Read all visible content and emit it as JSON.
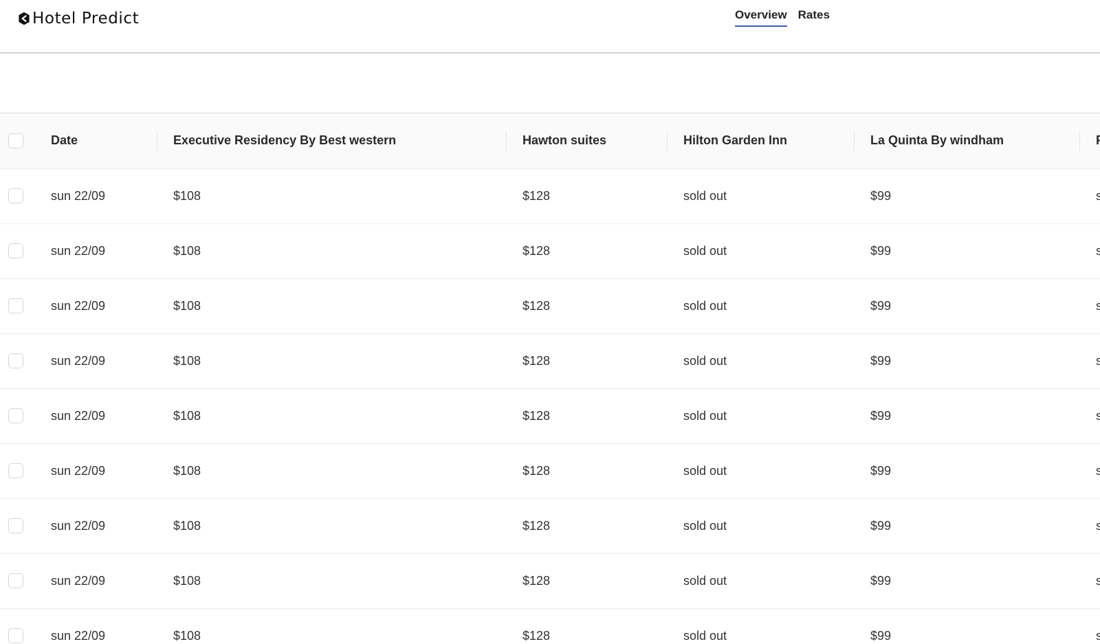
{
  "app": {
    "brand": "Hotel Predict",
    "nav": [
      {
        "label": "Overview",
        "active": true
      },
      {
        "label": "Rates",
        "active": false
      }
    ],
    "accent_color": "#3b5bdb"
  },
  "table": {
    "columns": [
      {
        "label": "Date"
      },
      {
        "label": "Executive Residency By Best western"
      },
      {
        "label": "Hawton suites"
      },
      {
        "label": "Hilton Garden Inn"
      },
      {
        "label": "La Quinta By windham"
      },
      {
        "label": "F"
      }
    ],
    "rows": [
      {
        "date": "sun 22/09",
        "exec": "$108",
        "hawton": "$128",
        "hilton": "sold out",
        "laquinta": "$99",
        "next": "s"
      },
      {
        "date": "sun 22/09",
        "exec": "$108",
        "hawton": "$128",
        "hilton": "sold out",
        "laquinta": "$99",
        "next": "s"
      },
      {
        "date": "sun 22/09",
        "exec": "$108",
        "hawton": "$128",
        "hilton": "sold out",
        "laquinta": "$99",
        "next": "s"
      },
      {
        "date": "sun 22/09",
        "exec": "$108",
        "hawton": "$128",
        "hilton": "sold out",
        "laquinta": "$99",
        "next": "s"
      },
      {
        "date": "sun 22/09",
        "exec": "$108",
        "hawton": "$128",
        "hilton": "sold out",
        "laquinta": "$99",
        "next": "s"
      },
      {
        "date": "sun 22/09",
        "exec": "$108",
        "hawton": "$128",
        "hilton": "sold out",
        "laquinta": "$99",
        "next": "s"
      },
      {
        "date": "sun 22/09",
        "exec": "$108",
        "hawton": "$128",
        "hilton": "sold out",
        "laquinta": "$99",
        "next": "s"
      },
      {
        "date": "sun 22/09",
        "exec": "$108",
        "hawton": "$128",
        "hilton": "sold out",
        "laquinta": "$99",
        "next": "s"
      },
      {
        "date": "sun 22/09",
        "exec": "$108",
        "hawton": "$128",
        "hilton": "sold out",
        "laquinta": "$99",
        "next": "s"
      }
    ]
  }
}
